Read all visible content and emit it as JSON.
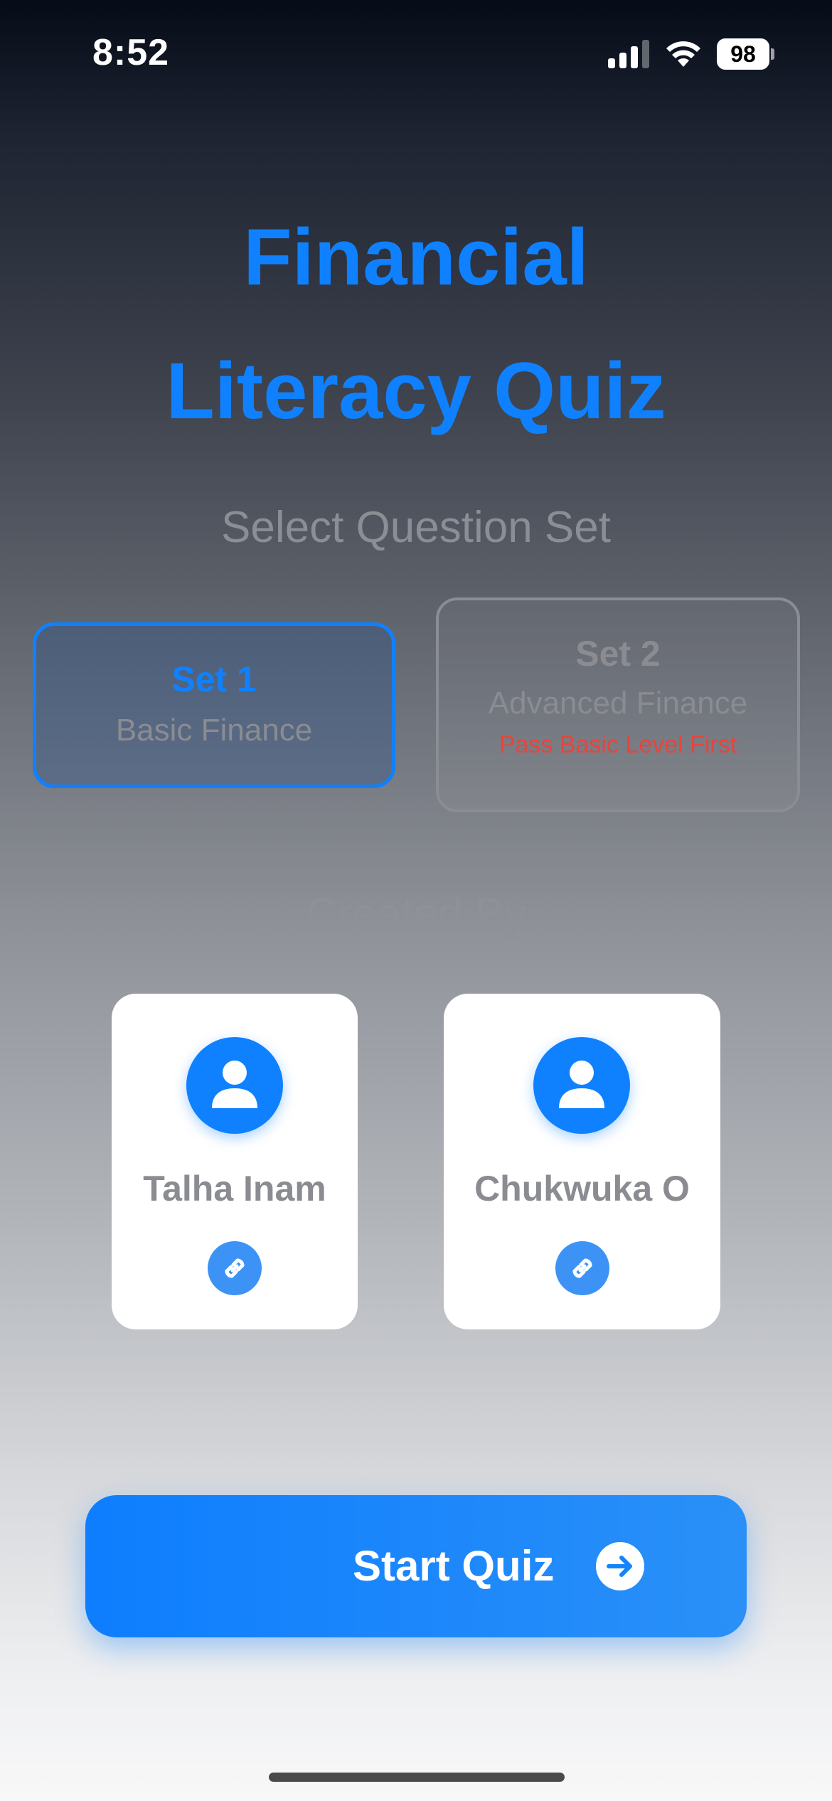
{
  "status_bar": {
    "time": "8:52",
    "battery_level": "98"
  },
  "header": {
    "title_line1": "Financial",
    "title_line2": "Literacy Quiz",
    "subtitle": "Select Question Set"
  },
  "question_sets": [
    {
      "name": "Set 1",
      "description": "Basic Finance",
      "selected": true
    },
    {
      "name": "Set 2",
      "description": "Advanced Finance",
      "lock_note": "Pass Basic Level First",
      "selected": false
    }
  ],
  "creators": {
    "heading": "Created By",
    "people": [
      {
        "name": "Talha Inam"
      },
      {
        "name": "Chukwuka O"
      }
    ]
  },
  "actions": {
    "start_label": "Start Quiz"
  },
  "colors": {
    "accent": "#0f81ff",
    "warning": "#e8443c"
  }
}
